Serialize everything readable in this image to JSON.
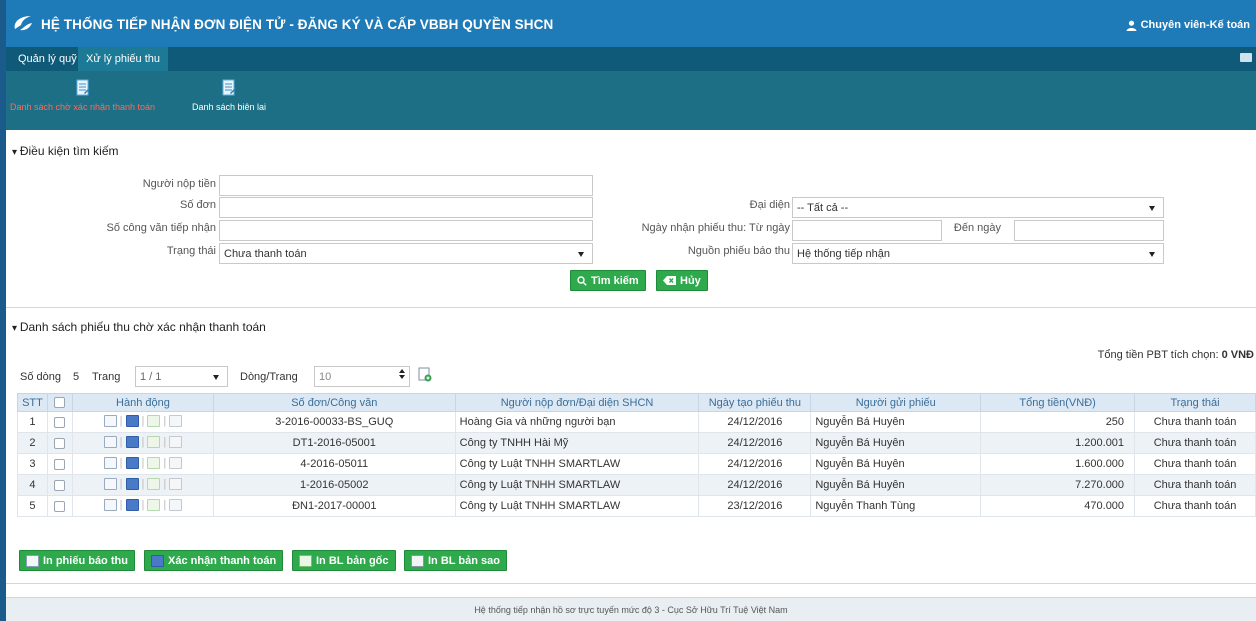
{
  "header": {
    "title": "HỆ THỐNG TIẾP NHẬN ĐƠN ĐIỆN TỬ - ĐĂNG KÝ VÀ CẤP VBBH QUYỀN SHCN",
    "user": "Chuyên viên-Kế toán",
    "brand_color": "#1f7bb8"
  },
  "menu": {
    "tabs": [
      {
        "label": "Quản lý quỹ"
      },
      {
        "label": "Xử lý phiếu thu"
      }
    ]
  },
  "toolbar": {
    "items": [
      {
        "label": "Danh sách chờ xác nhận thanh toán",
        "color": "#ff6a5a",
        "icon": "document-list-icon"
      },
      {
        "label": "Danh sách biên lai",
        "color": "#ffffff",
        "icon": "document-list-icon"
      }
    ]
  },
  "search": {
    "heading": "Điều kiện tìm kiếm",
    "payer_label": "Người nộp tiền",
    "payer_value": "",
    "app_no_label": "Số đơn",
    "app_no_value": "",
    "dispatch_label": "Số công văn tiếp nhận",
    "dispatch_value": "",
    "status_label": "Trạng thái",
    "status_value": "Chưa thanh toán",
    "rep_label": "Đại diện",
    "rep_value": "-- Tất cả --",
    "from_date_label": "Ngày nhận phiếu thu: Từ ngày",
    "from_date_value": "",
    "to_date_label": "Đến ngày",
    "to_date_value": "",
    "source_label": "Nguồn phiếu báo thu",
    "source_value": "Hệ thống tiếp nhận",
    "search_button": "Tìm kiếm",
    "cancel_button": "Hủy"
  },
  "list": {
    "heading": "Danh sách phiếu thu chờ xác nhận thanh toán",
    "total_label": "Tổng tiền PBT tích chọn:",
    "total_value": "0",
    "total_unit": "VNĐ",
    "rows_label": "Số dòng",
    "rows_count": "5",
    "page_label": "Trang",
    "page_value": "1 / 1",
    "per_page_label": "Dòng/Trang",
    "per_page_value": "10",
    "columns": [
      "STT",
      "Hành động",
      "Số đơn/Công văn",
      "Người nộp đơn/Đại diện SHCN",
      "Ngày tạo phiếu thu",
      "Người gửi phiếu",
      "Tổng tiền(VNĐ)",
      "Trạng thái"
    ],
    "rows": [
      {
        "stt": "1",
        "app_no": "3-2016-00033-BS_GUQ",
        "applicant": "Hoàng Gia và những người bạn",
        "date": "24/12/2016",
        "sender": "Nguyễn Bá Huyên",
        "amount": "250",
        "status": "Chưa thanh toán"
      },
      {
        "stt": "2",
        "app_no": "DT1-2016-05001",
        "applicant": "Công ty TNHH Hài Mỹ",
        "date": "24/12/2016",
        "sender": "Nguyễn Bá Huyên",
        "amount": "1.200.001",
        "status": "Chưa thanh toán"
      },
      {
        "stt": "3",
        "app_no": "4-2016-05011",
        "applicant": "Công ty Luật TNHH SMARTLAW",
        "date": "24/12/2016",
        "sender": "Nguyễn Bá Huyên",
        "amount": "1.600.000",
        "status": "Chưa thanh toán"
      },
      {
        "stt": "4",
        "app_no": "1-2016-05002",
        "applicant": "Công ty Luật TNHH SMARTLAW",
        "date": "24/12/2016",
        "sender": "Nguyễn Bá Huyên",
        "amount": "7.270.000",
        "status": "Chưa thanh toán"
      },
      {
        "stt": "5",
        "app_no": "ĐN1-2017-00001",
        "applicant": "Công ty Luật TNHH SMARTLAW",
        "date": "23/12/2016",
        "sender": "Nguyễn Thanh Tùng",
        "amount": "470.000",
        "status": "Chưa thanh toán"
      }
    ],
    "buttons": {
      "print_notice": "In phiếu báo thu",
      "confirm_payment": "Xác nhận thanh toán",
      "print_original": "In BL bản gốc",
      "print_copy": "In BL bản sao"
    }
  },
  "footer": {
    "text": "Hệ thống tiếp nhận hồ sơ trực tuyến mức độ 3 - Cục Sở Hữu Trí Tuệ Việt Nam"
  }
}
